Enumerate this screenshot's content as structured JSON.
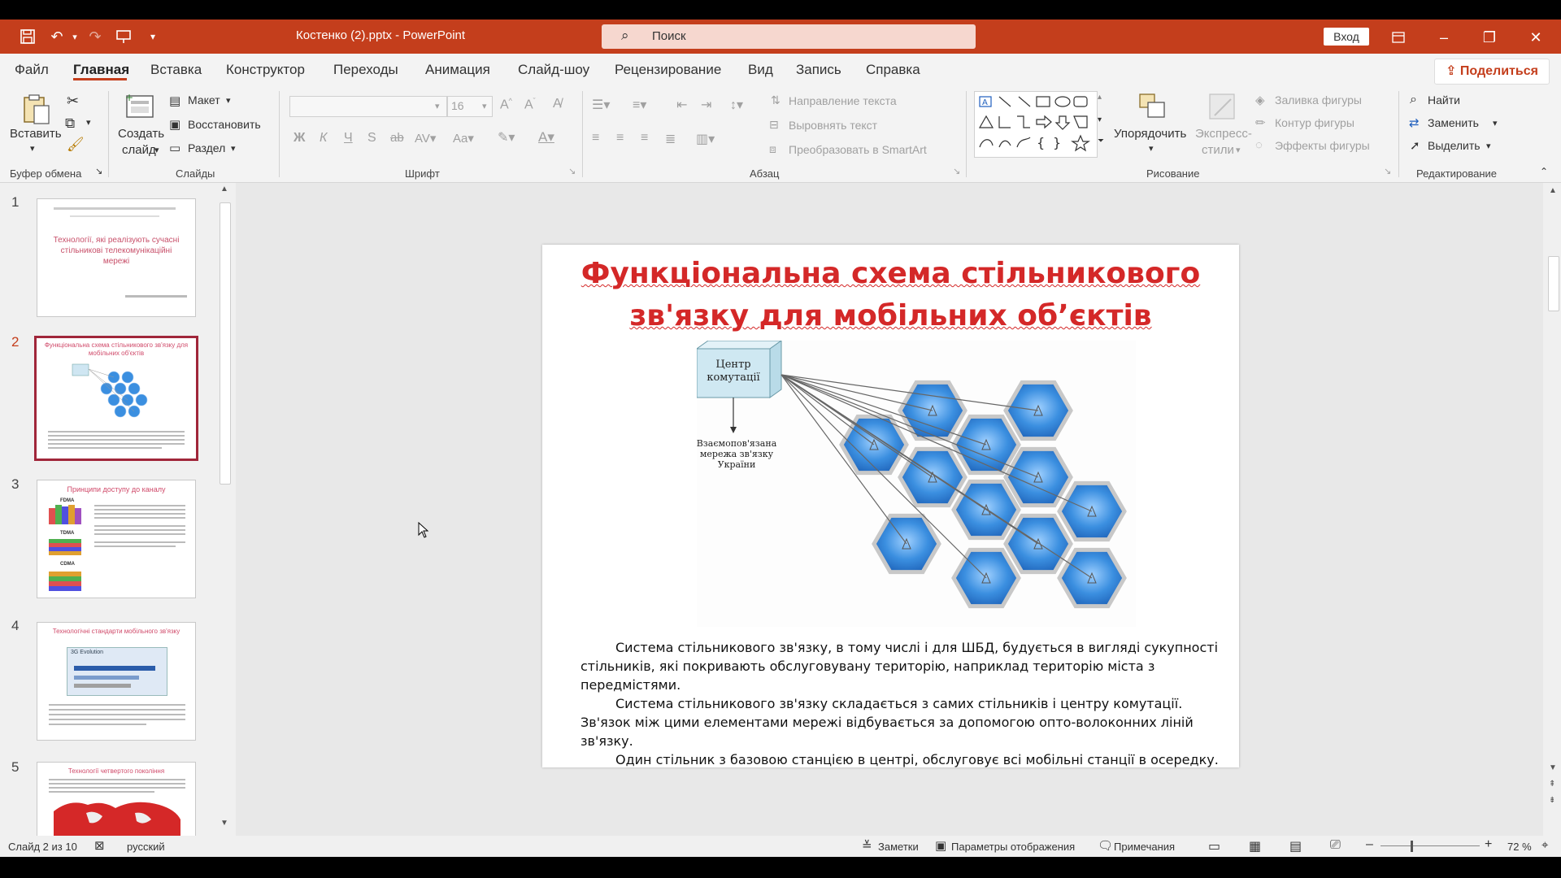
{
  "app": {
    "doc_title": "Костенко (2).pptx  -  PowerPoint",
    "search_placeholder": "Поиск",
    "signin_label": "Вход",
    "share_label": "Поделиться"
  },
  "menu": {
    "tabs": [
      "Файл",
      "Главная",
      "Вставка",
      "Конструктор",
      "Переходы",
      "Анимация",
      "Слайд-шоу",
      "Рецензирование",
      "Вид",
      "Запись",
      "Справка"
    ],
    "active_tab": "Главная"
  },
  "ribbon": {
    "clipboard": {
      "paste_label": "Вставить",
      "group_label": "Буфер обмена"
    },
    "slides": {
      "new_slide_label_1": "Создать",
      "new_slide_label_2": "слайд",
      "layout_label": "Макет",
      "reset_label": "Восстановить",
      "section_label": "Раздел",
      "group_label": "Слайды"
    },
    "font": {
      "font_name": "",
      "font_size": "16",
      "bold": "Ж",
      "italic": "К",
      "underline": "Ч",
      "strike": "S",
      "group_label": "Шрифт"
    },
    "paragraph": {
      "text_direction": "Направление текста",
      "align_text": "Выровнять текст",
      "convert_smartart": "Преобразовать в SmartArt",
      "group_label": "Абзац"
    },
    "drawing": {
      "arrange_label": "Упорядочить",
      "quick_styles_1": "Экспресс-",
      "quick_styles_2": "стили",
      "shape_fill": "Заливка фигуры",
      "shape_outline": "Контур фигуры",
      "shape_effects": "Эффекты фигуры",
      "group_label": "Рисование"
    },
    "editing": {
      "find_label": "Найти",
      "replace_label": "Заменить",
      "select_label": "Выделить",
      "group_label": "Редактирование"
    }
  },
  "thumbnails": [
    {
      "num": "1",
      "title": "Технології, які реалізують сучасні стільникові телекомунікаційні мережі"
    },
    {
      "num": "2",
      "title": "Функціональна схема стільникового зв'язку для мобільних об'єктів"
    },
    {
      "num": "3",
      "title": "Принципи доступу до каналу",
      "labels": [
        "FDMA",
        "TDMA",
        "CDMA"
      ]
    },
    {
      "num": "4",
      "title": "Технологічні стандарти мобільного зв'язку",
      "evo_label": "3G Evolution"
    },
    {
      "num": "5",
      "title": "Технології четвертого покоління"
    }
  ],
  "slide": {
    "title_line1": "Функціональна схема стільникового",
    "title_line2": "зв'язку для мобільних об’єктів",
    "diagram": {
      "center_label_1": "Центр",
      "center_label_2": "комутації",
      "network_label_1": "Взаємопов'язана",
      "network_label_2": "мережа зв'язку",
      "network_label_3": "України"
    },
    "body": {
      "p1": "Система стільникового зв'язку, в тому числі і для ШБД, будується в вигляді сукупності стільників, які покривають обслуговувану територію, наприклад територію міста з передмістями.",
      "p2": "Система стільникового зв'язку складається з самих стільників і центру комутації. Зв'язок між цими елементами мережі відбувається за допомогою опто-волоконних ліній зв'язку.",
      "p3": "Один стільник з базовою станцією в центрі, обслуговує всі мобільні станції в осередку."
    }
  },
  "status": {
    "slide_info": "Слайд 2 из 10",
    "language": "русский",
    "notes_label": "Заметки",
    "display_settings": "Параметры отображения",
    "comments_label": "Примечания",
    "zoom": "72 %"
  },
  "colors": {
    "accent": "#c43e1c",
    "title_red": "#d42828",
    "hex_blue": "#3b8fe0"
  }
}
